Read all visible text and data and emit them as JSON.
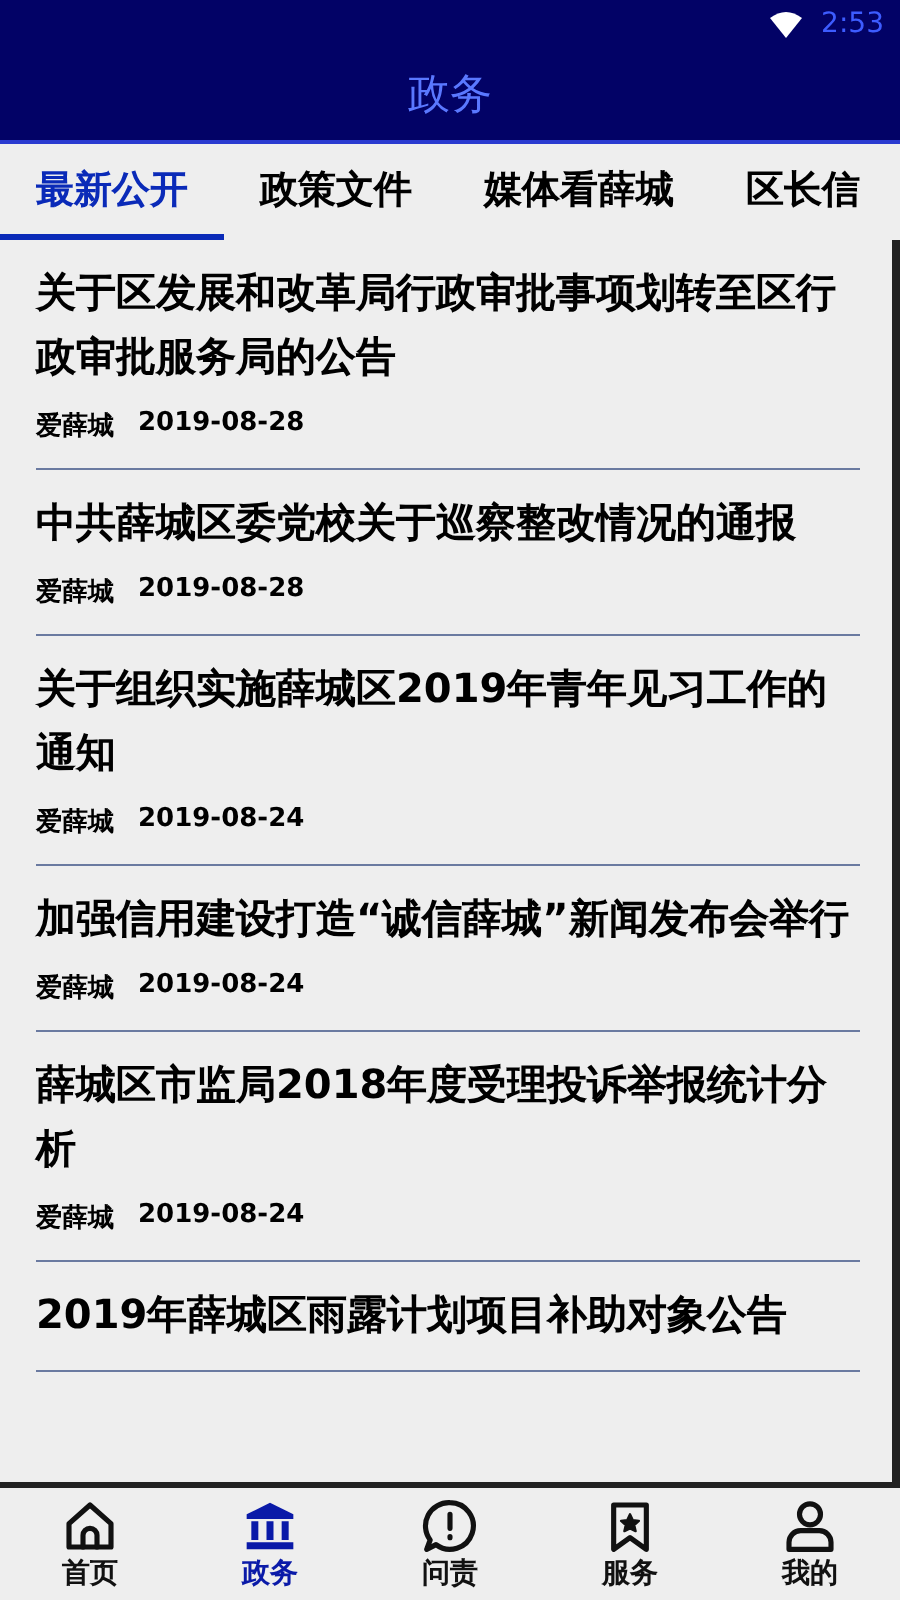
{
  "status_bar": {
    "time": "2:53"
  },
  "header": {
    "title": "政务"
  },
  "tabs": [
    {
      "label": "最新公开",
      "selected": true
    },
    {
      "label": "政策文件",
      "selected": false
    },
    {
      "label": "媒体看薛城",
      "selected": false
    },
    {
      "label": "区长信",
      "selected": false
    }
  ],
  "articles": [
    {
      "title": "关于区发展和改革局行政审批事项划转至区行政审批服务局的公告",
      "source": "爱薛城",
      "date": "2019-08-28"
    },
    {
      "title": "中共薛城区委党校关于巡察整改情况的通报",
      "source": "爱薛城",
      "date": "2019-08-28"
    },
    {
      "title": "关于组织实施薛城区2019年青年见习工作的通知",
      "source": "爱薛城",
      "date": "2019-08-24"
    },
    {
      "title": "加强信用建设打造“诚信薛城”新闻发布会举行",
      "source": "爱薛城",
      "date": "2019-08-24"
    },
    {
      "title": "薛城区市监局2018年度受理投诉举报统计分析",
      "source": "爱薛城",
      "date": "2019-08-24"
    },
    {
      "title": "2019年薛城区雨露计划项目补助对象公告"
    }
  ],
  "bottom_nav": [
    {
      "kind": "home",
      "label": "首页",
      "selected": false
    },
    {
      "kind": "bank",
      "label": "政务",
      "selected": true
    },
    {
      "kind": "alert",
      "label": "问责",
      "selected": false
    },
    {
      "kind": "bookmark",
      "label": "服务",
      "selected": false
    },
    {
      "kind": "user",
      "label": "我的",
      "selected": false
    }
  ]
}
